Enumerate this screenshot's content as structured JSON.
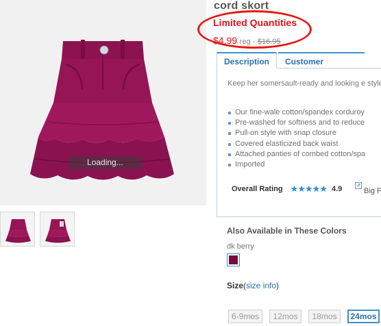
{
  "product": {
    "title": "cord skort",
    "promo": "Limited Quantities",
    "sale_price": "$4.99",
    "reg_label": "reg -",
    "reg_price": "$16.95",
    "loading_text": "Loading..."
  },
  "tabs": [
    {
      "label": "Description",
      "active": true
    },
    {
      "label": "Customer Reviews",
      "active": false
    }
  ],
  "description": {
    "intro": "Keep her somersault-ready and looking e style!",
    "features": [
      "Our fine-wale cotton/spandex corduroy",
      "Pre-washed for softness and to reduce",
      "Pull-on style with snap closure",
      "Covered elasticized back waist",
      "Attached panties of combed cotton/spa",
      "Imported"
    ]
  },
  "rating": {
    "label": "Overall Rating",
    "stars": "★★★★★",
    "value": "4.9",
    "link_text": "Big F"
  },
  "colors": {
    "heading": "Also Available in These Colors",
    "selected_name": "dk berry",
    "swatch_hex": "#7a0a3d"
  },
  "size": {
    "label": "Size",
    "open_paren": "(",
    "info_link": "size info",
    "close_paren": ")",
    "options": [
      "6-9mos",
      "12mos",
      "18mos",
      "24mos"
    ],
    "selected": "24mos"
  },
  "theme": {
    "accent": "#3d8fd1",
    "sale_red": "#e1121b",
    "product_color": "#8b1048"
  }
}
